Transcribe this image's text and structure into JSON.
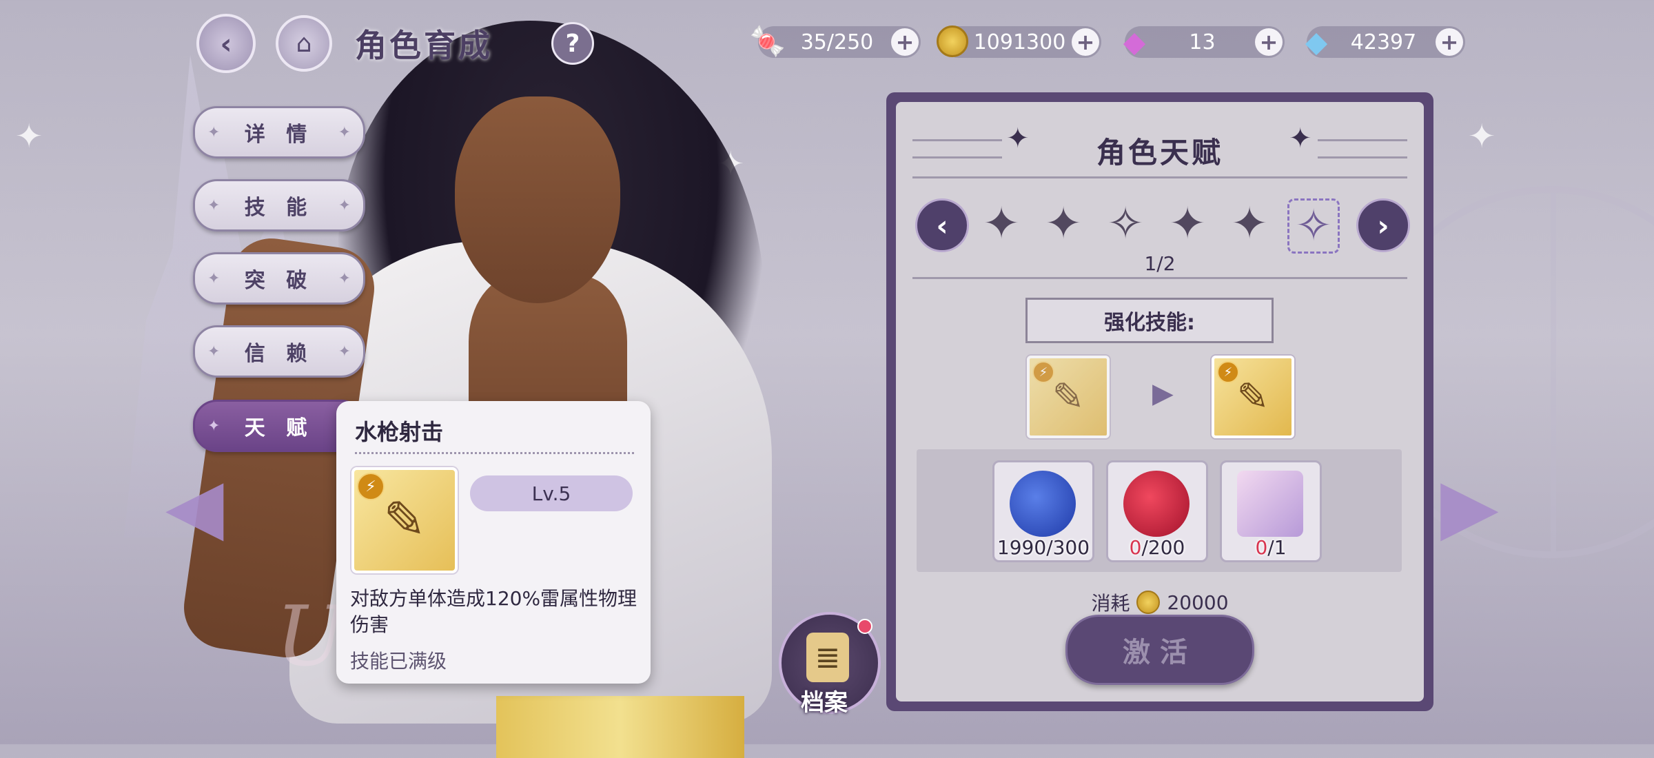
{
  "header": {
    "title": "角色育成",
    "back_icon": "back-arrow-icon",
    "home_icon": "castle-home-icon",
    "help_label": "?"
  },
  "currencies": [
    {
      "icon": "candy-icon",
      "value": "35/250",
      "plus": "+"
    },
    {
      "icon": "gold-coin-icon",
      "value": "1091300",
      "plus": "+"
    },
    {
      "icon": "pink-gem-icon",
      "value": "13",
      "plus": "+"
    },
    {
      "icon": "blue-diamond-icon",
      "value": "42397",
      "plus": "+"
    }
  ],
  "tabs": [
    {
      "label": "详 情",
      "active": false
    },
    {
      "label": "技 能",
      "active": false
    },
    {
      "label": "突 破",
      "active": false
    },
    {
      "label": "信 赖",
      "active": false
    },
    {
      "label": "天 赋",
      "active": true
    }
  ],
  "tooltip": {
    "title": "水枪射击",
    "level": "Lv.5",
    "description": "对敌方单体造成120%雷属性物理伤害",
    "status": "技能已满级",
    "icon": "water-gun-skill-icon"
  },
  "archive": {
    "label": "档案",
    "icon": "document-icon"
  },
  "talent_panel": {
    "title": "角色天赋",
    "page": "1/2",
    "prev_label": "‹",
    "next_label": "›",
    "enhance_label": "强化技能:",
    "materials": [
      {
        "icon": "blue-fruit-icon",
        "have": "1990",
        "need": "/300",
        "have_sufficient": true
      },
      {
        "icon": "red-berry-icon",
        "have": "0",
        "need": "/200",
        "have_sufficient": false
      },
      {
        "icon": "character-shard-icon",
        "have": "0",
        "need": "/1",
        "have_sufficient": false
      }
    ],
    "cost_label": "消耗",
    "cost_value": "20000",
    "activate_label": "激活"
  },
  "colors": {
    "panel": "#5a4874",
    "accent": "#6b4488",
    "insufficient": "#d8344f"
  }
}
